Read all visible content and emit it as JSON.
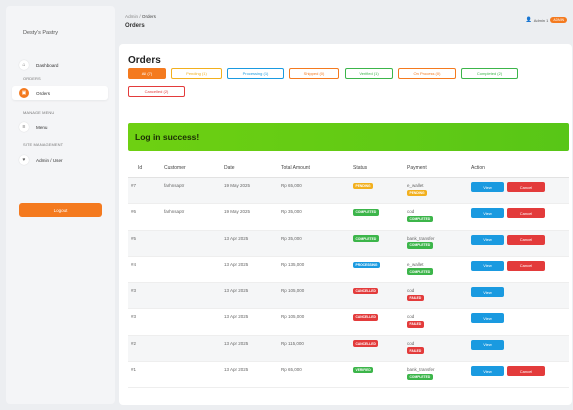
{
  "brand": "Desty's Pastry",
  "sidebar": {
    "items": [
      {
        "label": "Dashboard",
        "icon": "home-icon"
      },
      {
        "label": "Orders",
        "icon": "orders-icon",
        "active": true
      },
      {
        "label": "Menu",
        "icon": "menu-icon"
      },
      {
        "label": "Admin / User",
        "icon": "users-icon"
      }
    ],
    "sections": [
      "ORDERS",
      "MANAGE MENU",
      "SITE MANAGEMENT"
    ],
    "logout_label": "Logout"
  },
  "header": {
    "breadcrumb_root": "Admin",
    "breadcrumb_sep": "/",
    "breadcrumb_current": "Orders",
    "title": "Orders",
    "user_label": "Admin 1",
    "user_badge": "ADMIN"
  },
  "main": {
    "title": "Orders",
    "filters": [
      {
        "label": "All (7)",
        "color": "#f47a1f",
        "active": true
      },
      {
        "label": "Pending (1)",
        "color": "#f2b01e"
      },
      {
        "label": "Processing (1)",
        "color": "#1a9ae0"
      },
      {
        "label": "Shipped (0)",
        "color": "#f47a1f"
      },
      {
        "label": "Verified (1)",
        "color": "#3cb54a"
      },
      {
        "label": "On Process (0)",
        "color": "#f47a1f"
      },
      {
        "label": "Completed (2)",
        "color": "#3cb54a"
      },
      {
        "label": "Cancelled (2)",
        "color": "#e33b3b"
      }
    ],
    "alert": "Log in success!",
    "table": {
      "headers": [
        "Id",
        "Customer",
        "Date",
        "Total Amount",
        "Status",
        "Payment",
        "Action"
      ],
      "view_label": "View",
      "cancel_label": "Cancel",
      "rows": [
        {
          "id": "#7",
          "customer": "farhnsaptr",
          "date": "19 May 2025",
          "total": "Rp 65,000",
          "status": "PENDING",
          "status_color": "#f2b01e",
          "payment": "e_wallet",
          "pay_status": "PENDING",
          "pay_color": "#f2b01e",
          "cancel": true
        },
        {
          "id": "#6",
          "customer": "farhnsaptr",
          "date": "19 May 2025",
          "total": "Rp 35,000",
          "status": "COMPLETED",
          "status_color": "#3cb54a",
          "payment": "cod",
          "pay_status": "COMPLETED",
          "pay_color": "#3cb54a",
          "cancel": true
        },
        {
          "id": "#5",
          "customer": "",
          "date": "13 Apr 2025",
          "total": "Rp 35,000",
          "status": "COMPLETED",
          "status_color": "#3cb54a",
          "payment": "bank_transfer",
          "pay_status": "COMPLETED",
          "pay_color": "#3cb54a",
          "cancel": true
        },
        {
          "id": "#4",
          "customer": "",
          "date": "13 Apr 2025",
          "total": "Rp 135,000",
          "status": "PROCESSING",
          "status_color": "#1a9ae0",
          "payment": "e_wallet",
          "pay_status": "COMPLETED",
          "pay_color": "#3cb54a",
          "cancel": true
        },
        {
          "id": "#3",
          "customer": "",
          "date": "13 Apr 2025",
          "total": "Rp 105,000",
          "status": "CANCELLED",
          "status_color": "#e33b3b",
          "payment": "cod",
          "pay_status": "FAILED",
          "pay_color": "#e33b3b",
          "cancel": false
        },
        {
          "id": "#3",
          "customer": "",
          "date": "13 Apr 2025",
          "total": "Rp 105,000",
          "status": "CANCELLED",
          "status_color": "#e33b3b",
          "payment": "cod",
          "pay_status": "FAILED",
          "pay_color": "#e33b3b",
          "cancel": false
        },
        {
          "id": "#2",
          "customer": "",
          "date": "13 Apr 2025",
          "total": "Rp 115,000",
          "status": "CANCELLED",
          "status_color": "#e33b3b",
          "payment": "cod",
          "pay_status": "FAILED",
          "pay_color": "#e33b3b",
          "cancel": false
        },
        {
          "id": "#1",
          "customer": "",
          "date": "13 Apr 2025",
          "total": "Rp 65,000",
          "status": "VERIFIED",
          "status_color": "#3cb54a",
          "payment": "bank_transfer",
          "pay_status": "COMPLETED",
          "pay_color": "#3cb54a",
          "cancel": true
        }
      ]
    }
  }
}
